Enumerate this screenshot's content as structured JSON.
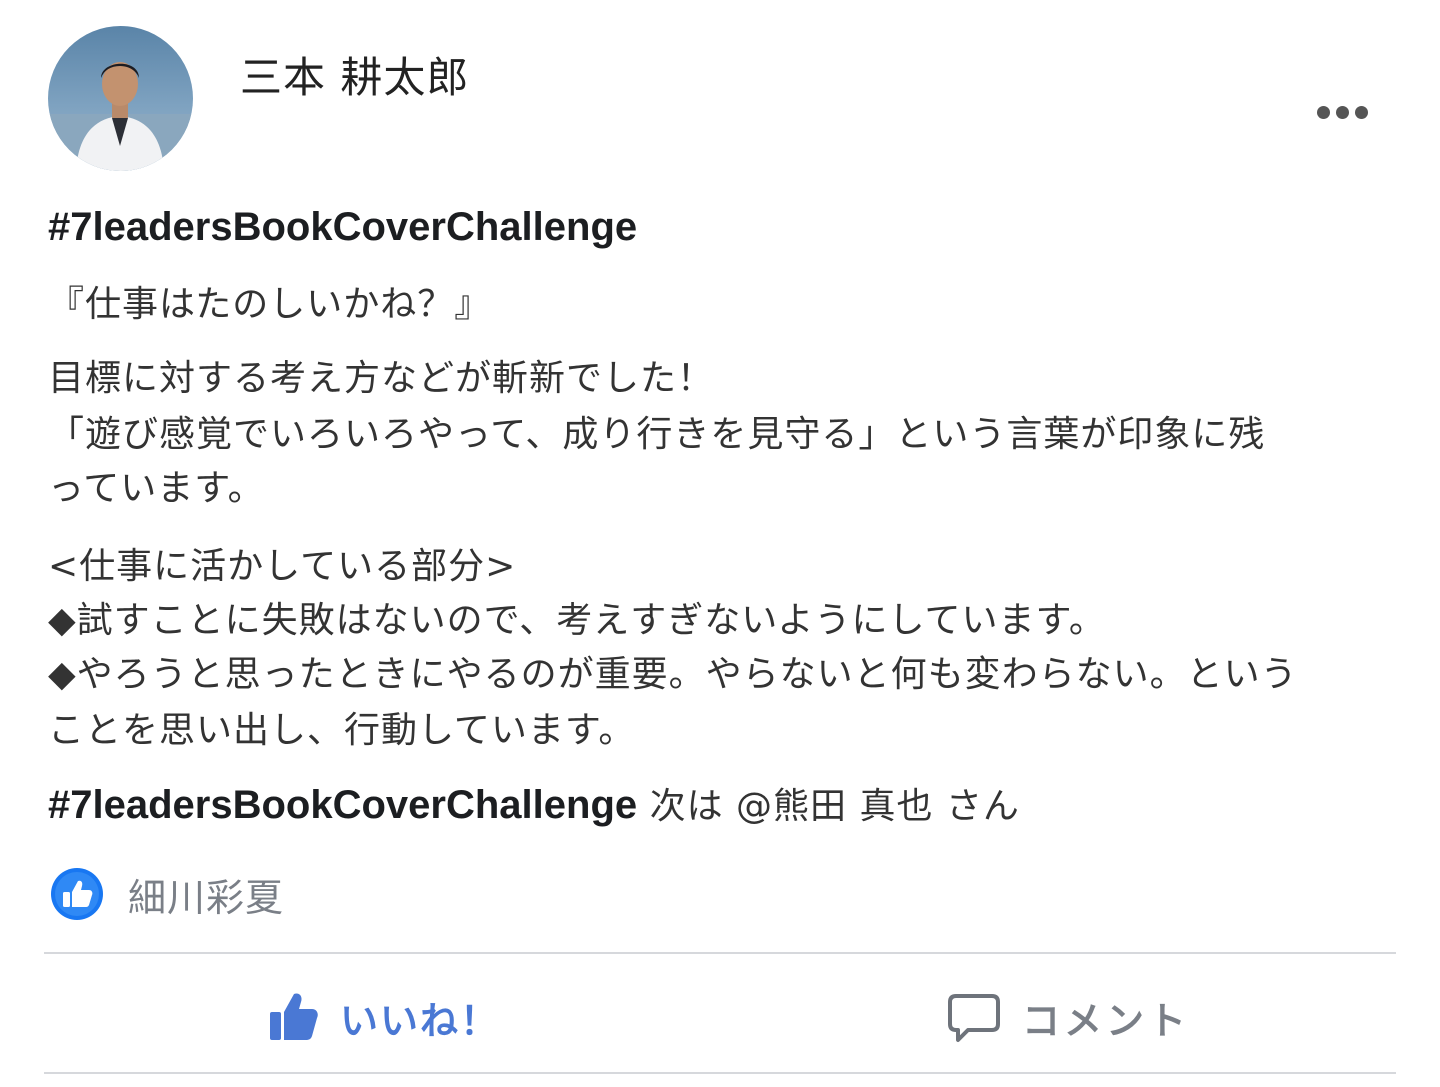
{
  "post": {
    "author": {
      "name": "三本 耕太郎"
    },
    "hashtag": "#7leadersBookCoverChallenge",
    "body": {
      "book_title": "『仕事はたのしいかね？』",
      "lines": [
        "目標に対する考え方などが斬新でした！",
        "「遊び感覚でいろいろやって、成り行きを見守る」という言葉が印象に残",
        "っています。"
      ],
      "section_heading": "<仕事に活かしている部分>",
      "bullets": [
        "◆試すことに失敗はないので、考えすぎないようにしています。",
        "◆やろうと思ったときにやるのが重要。やらないと何も変わらない。という",
        "ことを思い出し、行動しています。"
      ],
      "closing": {
        "hashtag": "#7leadersBookCoverChallenge",
        "text": " 次は ",
        "mention": "@熊田 真也",
        "suffix": " さん"
      }
    },
    "reactions": {
      "icon": "like-icon",
      "reactor": "細川彩夏"
    },
    "actions": {
      "like_label": "いいね！",
      "comment_label": "コメント"
    }
  },
  "colors": {
    "accent_blue": "#4a78d4",
    "like_badge": "#1877f2",
    "muted_text": "#7a7f87",
    "divider": "#d6d8dc"
  }
}
